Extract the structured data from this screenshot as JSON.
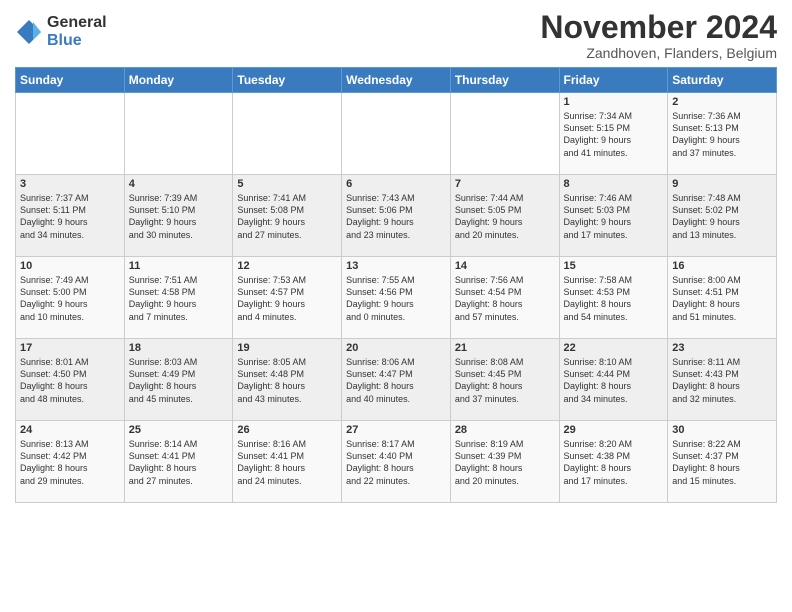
{
  "header": {
    "logo_general": "General",
    "logo_blue": "Blue",
    "title": "November 2024",
    "location": "Zandhoven, Flanders, Belgium"
  },
  "days_of_week": [
    "Sunday",
    "Monday",
    "Tuesday",
    "Wednesday",
    "Thursday",
    "Friday",
    "Saturday"
  ],
  "weeks": [
    [
      {
        "day": "",
        "info": ""
      },
      {
        "day": "",
        "info": ""
      },
      {
        "day": "",
        "info": ""
      },
      {
        "day": "",
        "info": ""
      },
      {
        "day": "",
        "info": ""
      },
      {
        "day": "1",
        "info": "Sunrise: 7:34 AM\nSunset: 5:15 PM\nDaylight: 9 hours\nand 41 minutes."
      },
      {
        "day": "2",
        "info": "Sunrise: 7:36 AM\nSunset: 5:13 PM\nDaylight: 9 hours\nand 37 minutes."
      }
    ],
    [
      {
        "day": "3",
        "info": "Sunrise: 7:37 AM\nSunset: 5:11 PM\nDaylight: 9 hours\nand 34 minutes."
      },
      {
        "day": "4",
        "info": "Sunrise: 7:39 AM\nSunset: 5:10 PM\nDaylight: 9 hours\nand 30 minutes."
      },
      {
        "day": "5",
        "info": "Sunrise: 7:41 AM\nSunset: 5:08 PM\nDaylight: 9 hours\nand 27 minutes."
      },
      {
        "day": "6",
        "info": "Sunrise: 7:43 AM\nSunset: 5:06 PM\nDaylight: 9 hours\nand 23 minutes."
      },
      {
        "day": "7",
        "info": "Sunrise: 7:44 AM\nSunset: 5:05 PM\nDaylight: 9 hours\nand 20 minutes."
      },
      {
        "day": "8",
        "info": "Sunrise: 7:46 AM\nSunset: 5:03 PM\nDaylight: 9 hours\nand 17 minutes."
      },
      {
        "day": "9",
        "info": "Sunrise: 7:48 AM\nSunset: 5:02 PM\nDaylight: 9 hours\nand 13 minutes."
      }
    ],
    [
      {
        "day": "10",
        "info": "Sunrise: 7:49 AM\nSunset: 5:00 PM\nDaylight: 9 hours\nand 10 minutes."
      },
      {
        "day": "11",
        "info": "Sunrise: 7:51 AM\nSunset: 4:58 PM\nDaylight: 9 hours\nand 7 minutes."
      },
      {
        "day": "12",
        "info": "Sunrise: 7:53 AM\nSunset: 4:57 PM\nDaylight: 9 hours\nand 4 minutes."
      },
      {
        "day": "13",
        "info": "Sunrise: 7:55 AM\nSunset: 4:56 PM\nDaylight: 9 hours\nand 0 minutes."
      },
      {
        "day": "14",
        "info": "Sunrise: 7:56 AM\nSunset: 4:54 PM\nDaylight: 8 hours\nand 57 minutes."
      },
      {
        "day": "15",
        "info": "Sunrise: 7:58 AM\nSunset: 4:53 PM\nDaylight: 8 hours\nand 54 minutes."
      },
      {
        "day": "16",
        "info": "Sunrise: 8:00 AM\nSunset: 4:51 PM\nDaylight: 8 hours\nand 51 minutes."
      }
    ],
    [
      {
        "day": "17",
        "info": "Sunrise: 8:01 AM\nSunset: 4:50 PM\nDaylight: 8 hours\nand 48 minutes."
      },
      {
        "day": "18",
        "info": "Sunrise: 8:03 AM\nSunset: 4:49 PM\nDaylight: 8 hours\nand 45 minutes."
      },
      {
        "day": "19",
        "info": "Sunrise: 8:05 AM\nSunset: 4:48 PM\nDaylight: 8 hours\nand 43 minutes."
      },
      {
        "day": "20",
        "info": "Sunrise: 8:06 AM\nSunset: 4:47 PM\nDaylight: 8 hours\nand 40 minutes."
      },
      {
        "day": "21",
        "info": "Sunrise: 8:08 AM\nSunset: 4:45 PM\nDaylight: 8 hours\nand 37 minutes."
      },
      {
        "day": "22",
        "info": "Sunrise: 8:10 AM\nSunset: 4:44 PM\nDaylight: 8 hours\nand 34 minutes."
      },
      {
        "day": "23",
        "info": "Sunrise: 8:11 AM\nSunset: 4:43 PM\nDaylight: 8 hours\nand 32 minutes."
      }
    ],
    [
      {
        "day": "24",
        "info": "Sunrise: 8:13 AM\nSunset: 4:42 PM\nDaylight: 8 hours\nand 29 minutes."
      },
      {
        "day": "25",
        "info": "Sunrise: 8:14 AM\nSunset: 4:41 PM\nDaylight: 8 hours\nand 27 minutes."
      },
      {
        "day": "26",
        "info": "Sunrise: 8:16 AM\nSunset: 4:41 PM\nDaylight: 8 hours\nand 24 minutes."
      },
      {
        "day": "27",
        "info": "Sunrise: 8:17 AM\nSunset: 4:40 PM\nDaylight: 8 hours\nand 22 minutes."
      },
      {
        "day": "28",
        "info": "Sunrise: 8:19 AM\nSunset: 4:39 PM\nDaylight: 8 hours\nand 20 minutes."
      },
      {
        "day": "29",
        "info": "Sunrise: 8:20 AM\nSunset: 4:38 PM\nDaylight: 8 hours\nand 17 minutes."
      },
      {
        "day": "30",
        "info": "Sunrise: 8:22 AM\nSunset: 4:37 PM\nDaylight: 8 hours\nand 15 minutes."
      }
    ]
  ]
}
